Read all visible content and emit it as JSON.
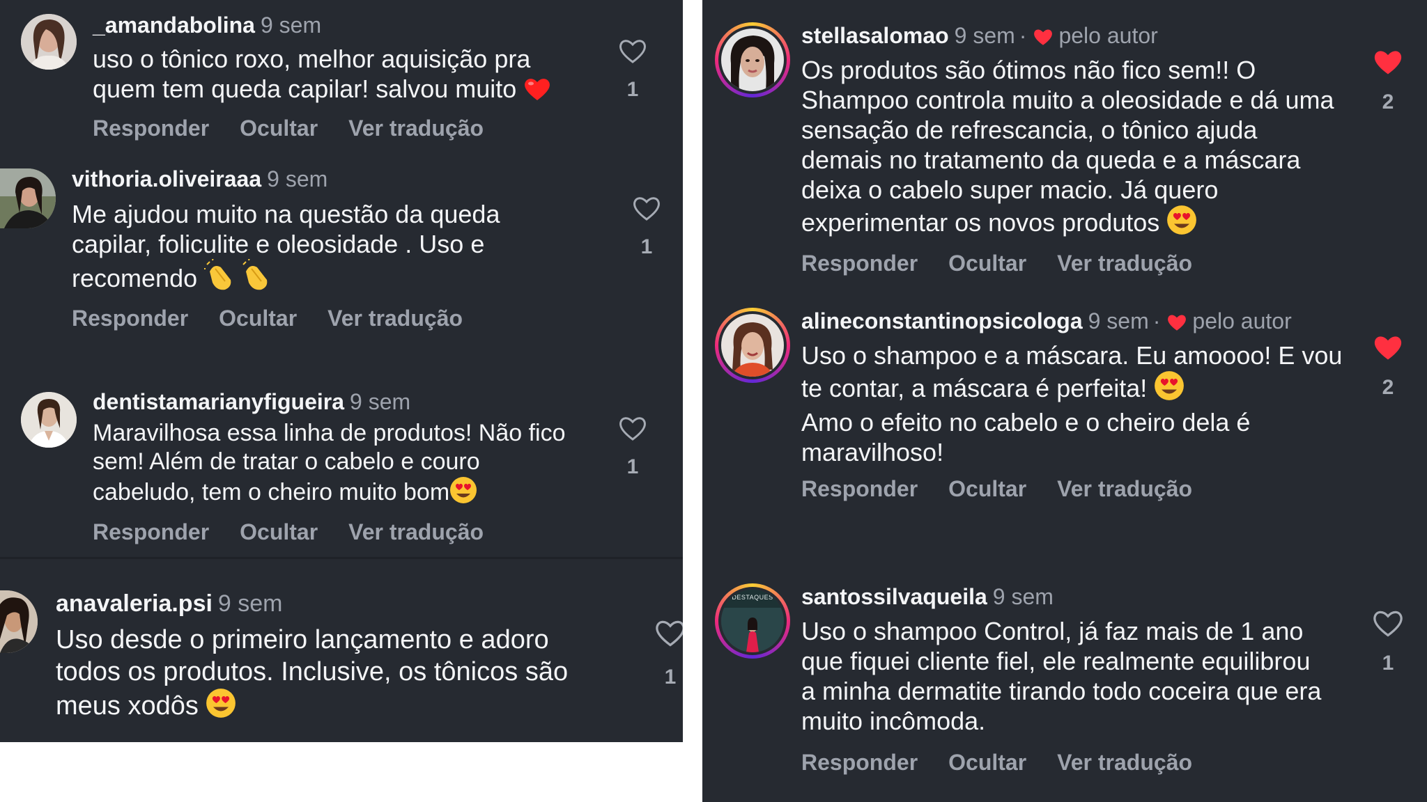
{
  "actions": {
    "reply": "Responder",
    "hide": "Ocultar",
    "translate": "Ver tradução"
  },
  "left_comments": [
    {
      "username": "_amandabolina",
      "time": "9 sem",
      "text": "uso o tônico roxo, melhor aquisição pra quem tem queda capilar! salvou muito",
      "likes": "1",
      "emoji": "red-heart"
    },
    {
      "username": "vithoria.oliveiraaa",
      "time": "9 sem",
      "text": "Me ajudou muito na questão da queda capilar, foliculite e oleosidade . Uso e recomendo",
      "likes": "1",
      "emoji": "clapping-hands"
    },
    {
      "username": "dentistamarianyfigueira",
      "time": "9 sem",
      "text": "Maravilhosa essa linha de produtos! Não fico sem! Além de tratar o cabelo e couro cabeludo, tem o cheiro muito bom",
      "likes": "1",
      "emoji": "heart-eyes"
    },
    {
      "username": "anavaleria.psi",
      "time": "9 sem",
      "text": "Uso desde o primeiro lançamento e adoro todos os produtos. Inclusive, os tônicos são meus xodôs",
      "likes": "1",
      "emoji": "heart-eyes"
    }
  ],
  "right_comments": [
    {
      "username": "stellasalomao",
      "time": "9 sem",
      "author_tag": "pelo autor",
      "text": "Os produtos são ótimos não fico sem!! O Shampoo controla muito a oleosidade e dá uma sensação de refrescancia, o tônico ajuda demais no tratamento da queda e a máscara deixa o cabelo super macio. Já quero experimentar os novos produtos",
      "likes": "2",
      "liked": true,
      "emoji": "heart-eyes"
    },
    {
      "username": "alineconstantinopsicologa",
      "time": "9 sem",
      "author_tag": "pelo autor",
      "text_1": "Uso o shampoo e a máscara. Eu amoooo! E vou te contar, a máscara é perfeita!",
      "text_2": "Amo o efeito no cabelo e o cheiro dela é maravilhoso!",
      "likes": "2",
      "liked": true,
      "emoji": "heart-eyes"
    },
    {
      "username": "santossilvaqueila",
      "time": "9 sem",
      "text": "Uso o shampoo Control, já faz mais de 1 ano que fiquei cliente fiel, ele realmente equilibrou a minha dermatite tirando todo coceira que era muito incômoda.",
      "likes": "1",
      "liked": false,
      "avatar_label": "DESTAQUES"
    }
  ],
  "separator": "·",
  "colors": {
    "background": "#262a31",
    "liked_heart": "#ff3040",
    "muted_text": "#9ea3ad"
  }
}
